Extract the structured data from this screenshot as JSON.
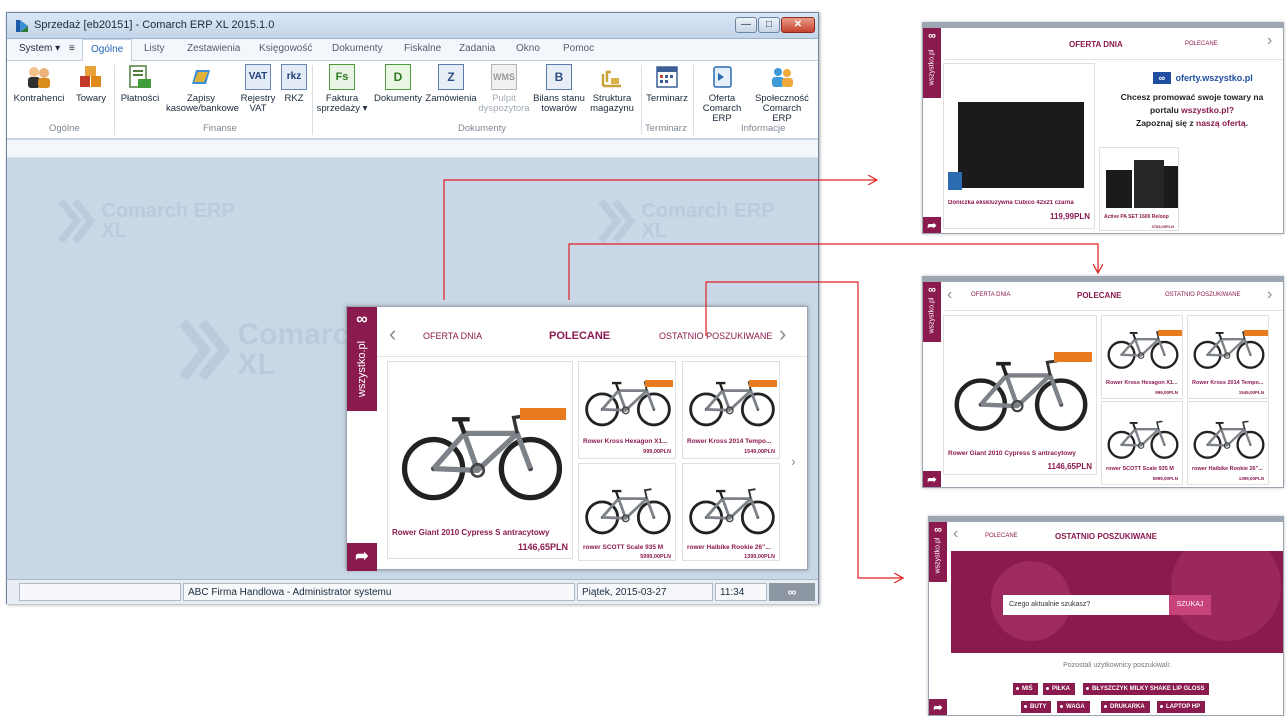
{
  "window": {
    "title": "Sprzedaż [eb20151] - Comarch ERP XL 2015.1.0",
    "min_label": "—",
    "max_label": "□",
    "close_label": "✕"
  },
  "menu": {
    "system": "System ▾",
    "quick_access": "≡",
    "tabs": [
      "Ogólne",
      "Listy",
      "Zestawienia",
      "Księgowość",
      "Dokumenty",
      "Fiskalne",
      "Zadania",
      "Okno",
      "Pomoc"
    ]
  },
  "ribbon": {
    "buttons": [
      {
        "line1": "Kontrahenci",
        "line2": ""
      },
      {
        "line1": "Towary",
        "line2": ""
      },
      {
        "line1": "Płatności",
        "line2": ""
      },
      {
        "line1": "Zapisy",
        "line2": "kasowe/bankowe"
      },
      {
        "line1": "Rejestry",
        "line2": "VAT"
      },
      {
        "line1": "RKZ",
        "line2": ""
      },
      {
        "line1": "Faktura",
        "line2": "sprzedaży ▾"
      },
      {
        "line1": "Dokumenty",
        "line2": ""
      },
      {
        "line1": "Zamówienia",
        "line2": ""
      },
      {
        "line1": "Pulpit",
        "line2": "dyspozytora"
      },
      {
        "line1": "Bilans stanu",
        "line2": "towarów"
      },
      {
        "line1": "Struktura",
        "line2": "magazynu"
      },
      {
        "line1": "Terminarz",
        "line2": ""
      },
      {
        "line1": "Oferta",
        "line2": "Comarch ERP"
      },
      {
        "line1": "Społeczność",
        "line2": "Comarch ERP"
      }
    ],
    "icons": {
      "vat": "VAT",
      "rkz": "rkz",
      "fs": "Fs",
      "d": "D",
      "z": "Z",
      "wms": "WMS",
      "b": "B"
    },
    "groups": [
      "Ogólne",
      "Finanse",
      "Dokumenty",
      "Terminarz",
      "Informacje"
    ]
  },
  "watermark": {
    "line1": "Comarch ERP",
    "line2": "XL"
  },
  "status": {
    "company": "ABC Firma Handlowa - Administrator systemu",
    "date": "Piątek, 2015-03-27",
    "time": "11:34",
    "infinity": "∞"
  },
  "widget_tab": {
    "infinity": "∞",
    "brand": "wszystko.pl",
    "share": "➦"
  },
  "main_widget": {
    "tabs": {
      "left": "OFERTA DNIA",
      "active": "POLECANE",
      "right": "OSTATNIO POSZUKIWANE"
    },
    "arrows": {
      "left": "‹",
      "right": "›",
      "more": "›"
    },
    "featured": {
      "name": "Rower Giant 2010 Cypress S antracytowy",
      "price": "1146,65PLN"
    },
    "products": [
      {
        "name": "Rower Kross Hexagon X1...",
        "price": "999,00PLN"
      },
      {
        "name": "Rower Kross 2014 Tempo...",
        "price": "1549,00PLN"
      },
      {
        "name": "rower SCOTT Scale 935 M",
        "price": "5999,00PLN"
      },
      {
        "name": "rower Haibike Rookie 26\"...",
        "price": "1399,00PLN"
      }
    ]
  },
  "panel_oferta": {
    "brand": "wszystko.pl",
    "active": "OFERTA DNIA",
    "right": "POLECANE",
    "logo_text": "oferty.wszystko.pl",
    "promo_line1": "Chcesz promować swoje towary na",
    "promo_line2_a": "portalu ",
    "promo_link1": "wszystko.pl?",
    "promo_line3_a": "Zapoznaj się z ",
    "promo_link2": "naszą ofertą",
    "promo_line3_b": ".",
    "product1": {
      "name": "Doniczka ekskluzywna Cubico 42x21 czarna",
      "price": "119,99PLN"
    },
    "product2": {
      "name": "Active PA SET 1600 Reloop",
      "price": "3769,00PLN"
    }
  },
  "panel_polecane": {
    "brand": "wszystko.pl",
    "left": "OFERTA DNIA",
    "active": "POLECANE",
    "right": "OSTATNIO POSZUKIWANE",
    "featured": {
      "name": "Rower Giant 2010 Cypress S antracytowy",
      "price": "1146,65PLN"
    },
    "products": [
      {
        "name": "Rower Kross Hexagon X1...",
        "price": "999,00PLN"
      },
      {
        "name": "Rower Kross 2014 Tempo...",
        "price": "1549,00PLN"
      },
      {
        "name": "rower SCOTT Scale 935 M",
        "price": "5999,00PLN"
      },
      {
        "name": "rower Haibike Rookie 26\"...",
        "price": "1399,00PLN"
      }
    ]
  },
  "panel_search": {
    "brand": "wszystko.pl",
    "left": "POLECANE",
    "active": "OSTATNIO POSZUKIWANE",
    "placeholder": "Czego aktualnie szukasz?",
    "button": "SZUKAJ",
    "others": "Pozostali użytkownicy poszukiwali:",
    "tags": [
      "MIŚ",
      "PIŁKA",
      "BŁYSZCZYK MILKY SHAKE LIP GLOSS",
      "BUTY",
      "WAGA",
      "DRUKARKA",
      "LAPTOP HP"
    ]
  },
  "colors": {
    "accent": "#8b1a4e",
    "connector": "#e02020",
    "workspace": "#c9d7e6"
  }
}
